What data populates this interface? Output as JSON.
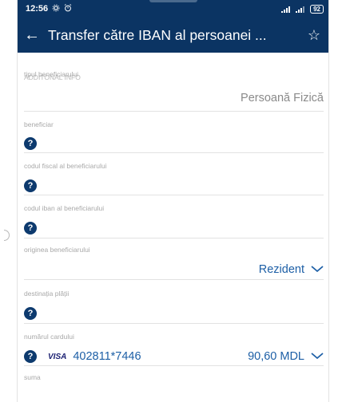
{
  "status_bar": {
    "time": "12:56",
    "battery": "92"
  },
  "header": {
    "title": "Transfer către IBAN al persoanei ..."
  },
  "form": {
    "section_title": "ADDITONAL INFO",
    "beneficiary_type_label": "tipul beneficiarului",
    "beneficiary_type_value": "Persoană Fizică",
    "beneficiary_label": "beneficiar",
    "fiscal_code_label": "codul fiscal al beneficiarului",
    "iban_label": "codul iban al beneficiarului",
    "origin_label": "originea beneficiarului",
    "origin_value": "Rezident",
    "payment_destination_label": "destinația plății",
    "card_number_label": "numărul cardului",
    "card_brand": "VISA",
    "card_number": "402811*7446",
    "card_balance": "90,60 MDL",
    "amount_label": "suma"
  },
  "colors": {
    "header_bg": "#0b3463",
    "accent": "#1d5fa6"
  }
}
